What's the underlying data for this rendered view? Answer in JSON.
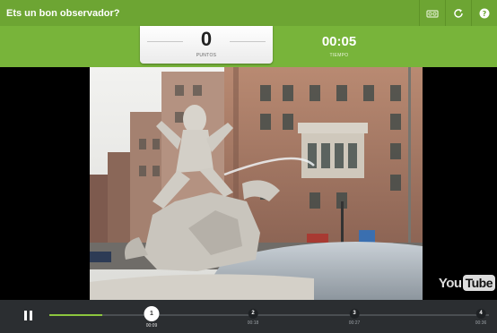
{
  "window": {
    "title": "Ets un bon observador?"
  },
  "toolbar": {
    "icons": [
      "glasses-icon",
      "reload-icon",
      "help-icon"
    ]
  },
  "score": {
    "value": "0",
    "label": "PUNTOS"
  },
  "timer": {
    "value": "00:05",
    "label": "TIEMPO"
  },
  "video": {
    "brand_you": "You",
    "brand_tube": "Tube"
  },
  "controls": {
    "progress_fraction": 0.12,
    "markers": [
      {
        "number": "1",
        "time": "00:09",
        "active": true
      },
      {
        "number": "2",
        "time": "00:18",
        "active": false
      },
      {
        "number": "3",
        "time": "00:27",
        "active": false
      },
      {
        "number": "4",
        "time": "00:36",
        "active": false
      }
    ]
  },
  "colors": {
    "title_bar": "#6da533",
    "score_band": "#78b43a",
    "progress": "#8cc63e",
    "control_bar": "#2b2e31"
  }
}
